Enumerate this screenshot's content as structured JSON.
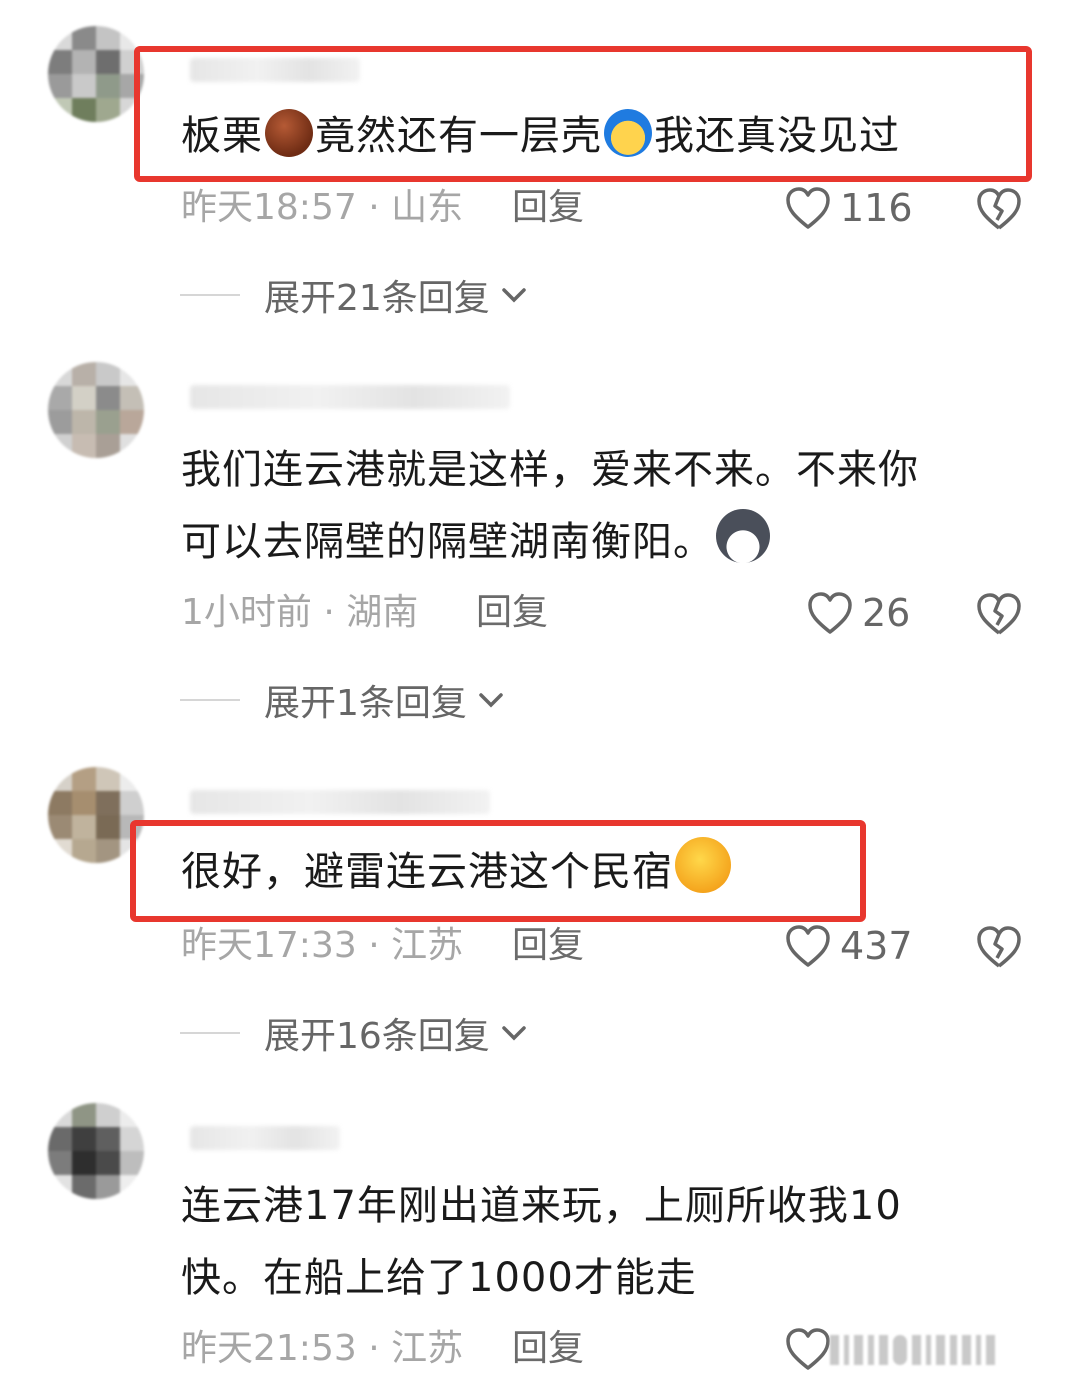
{
  "comments": [
    {
      "text_before": "板栗",
      "text_mid": "竟然还有一层壳",
      "text_after": "我还真没见过",
      "time_location": "昨天18:57 · 山东",
      "reply_label": "回复",
      "likes": "116",
      "expand_label": "展开21条回复"
    },
    {
      "text_line1": "我们连云港就是这样，爱来不来。不来你",
      "text_line2": "可以去隔壁的隔壁湖南衡阳。",
      "time_location": "1小时前 · 湖南",
      "reply_label": "回复",
      "likes": "26",
      "expand_label": "展开1条回复"
    },
    {
      "text": "很好，避雷连云港这个民宿",
      "time_location": "昨天17:33 · 江苏",
      "reply_label": "回复",
      "likes": "437",
      "expand_label": "展开16条回复"
    },
    {
      "text_line1": "连云港17年刚出道来玩，上厕所收我10",
      "text_line2": "快。在船上给了1000才能走",
      "time_location": "昨天21:53 · 江苏",
      "reply_label": "回复"
    }
  ],
  "icons": {
    "like": "heart-outline-icon",
    "dislike": "broken-heart-icon",
    "expand": "chevron-down-icon",
    "emoji_1": "chestnut-emoji-icon",
    "emoji_2": "blue-hair-face-emoji-icon",
    "emoji_3": "husky-dog-emoji-icon",
    "emoji_4": "smirking-thinking-emoji-icon"
  },
  "colors": {
    "highlight_border": "#e8372e",
    "meta_text": "#a6a6a6",
    "body_text": "#1a1a1a"
  }
}
